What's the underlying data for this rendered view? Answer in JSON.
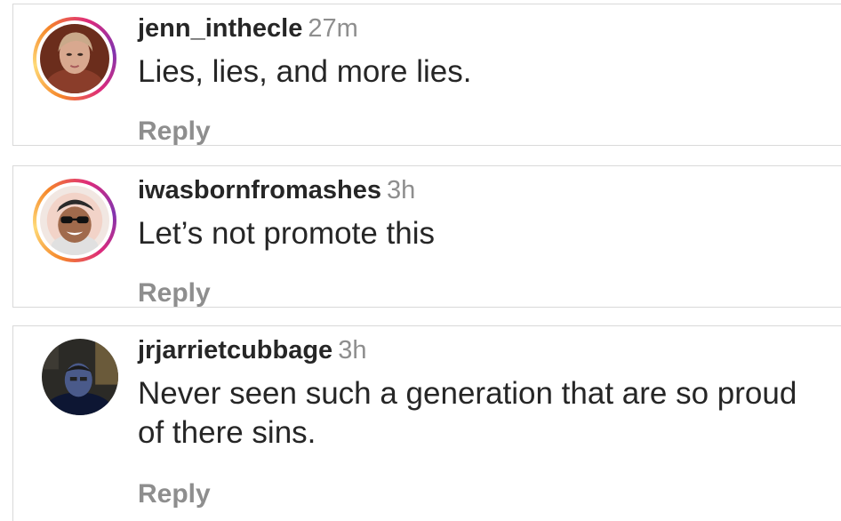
{
  "comments": [
    {
      "username": "jenn_inthecle",
      "time": "27m",
      "text": "Lies, lies, and more lies.",
      "reply_label": "Reply",
      "has_story_ring": true
    },
    {
      "username": "iwasbornfromashes",
      "time": "3h",
      "text": "Let’s not promote this",
      "reply_label": "Reply",
      "has_story_ring": true
    },
    {
      "username": "jrjarrietcubbage",
      "time": "3h",
      "text": "Never seen such a generation that are so proud of there sins.",
      "reply_label": "Reply",
      "has_story_ring": false
    }
  ],
  "colors": {
    "username": "#262626",
    "muted": "#8e8e8e",
    "divider": "#d9d9d9",
    "story_ring_gradient": [
      "#f58529",
      "#feda77",
      "#dd2a7b",
      "#8134af"
    ]
  }
}
